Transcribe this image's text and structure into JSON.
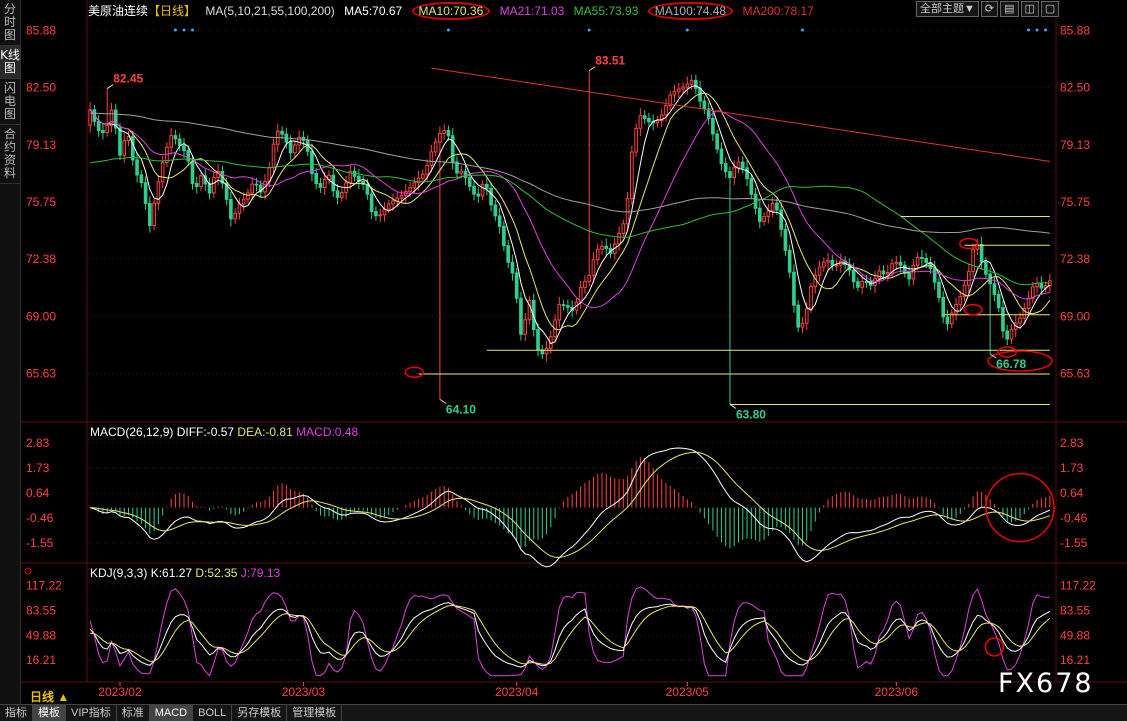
{
  "sidebar": {
    "tabs": [
      {
        "label": "分时图",
        "active": false
      },
      {
        "label": "K线图",
        "active": true
      },
      {
        "label": "闪电图",
        "active": false
      },
      {
        "label": "合约资料",
        "active": false
      }
    ]
  },
  "header": {
    "symbol": "美原油连续",
    "period_tag": "【日线】",
    "ma_params": "MA(5,10,21,55,100,200)",
    "ma5": "MA5:70.67",
    "ma10": "MA10:70.36",
    "ma21": "MA21:71.03",
    "ma55": "MA55:73.93",
    "ma100": "MA100:74.48",
    "ma200": "MA200:78.17"
  },
  "top_buttons": {
    "theme": "全部主题",
    "theme_arrow": "▼"
  },
  "colors": {
    "up": "#ff4040",
    "down": "#2ecf8f",
    "ma5": "#ffffff",
    "ma10": "#e8e870",
    "ma21": "#e040e0",
    "ma55": "#30c030",
    "ma100": "#a0a0a0",
    "ma200": "#e03030",
    "axis": "#ff4040",
    "grid": "#3a1010"
  },
  "period_label": "日线 ▲",
  "watermark": "FX678",
  "bottom_tabs": [
    {
      "label": "指标",
      "active": false
    },
    {
      "label": "模板",
      "active": true
    },
    {
      "label": "VIP指标",
      "active": false
    },
    {
      "label": "标准",
      "active": false
    },
    {
      "label": "MACD",
      "active": true
    },
    {
      "label": "BOLL",
      "active": false
    },
    {
      "label": "另存模板",
      "active": false
    },
    {
      "label": "管理模板",
      "active": false
    }
  ],
  "chart_data": [
    {
      "type": "candlestick",
      "title": "美原油连续【日线】",
      "ylim": [
        63.0,
        86.5
      ],
      "y_ticks": [
        85.88,
        82.5,
        79.13,
        75.75,
        72.38,
        69.0,
        65.63
      ],
      "x_labels": [
        "2023/02",
        "2023/03",
        "2023/04",
        "2023/05",
        "2023/06"
      ],
      "x_label_index": [
        7,
        50,
        100,
        140,
        189
      ],
      "annotations": [
        {
          "text": "82.45",
          "i": 4,
          "value": 82.45,
          "kind": "high"
        },
        {
          "text": "83.51",
          "i": 117,
          "value": 83.51,
          "kind": "high"
        },
        {
          "text": "64.10",
          "i": 82,
          "value": 64.1,
          "kind": "low"
        },
        {
          "text": "63.80",
          "i": 150,
          "value": 63.8,
          "kind": "low"
        },
        {
          "text": "66.78",
          "i": 211,
          "value": 66.78,
          "kind": "low"
        }
      ],
      "candles": [
        [
          80.3,
          81.4,
          80.0,
          81.2
        ],
        [
          81.2,
          81.7,
          79.8,
          80.0
        ],
        [
          80.0,
          80.2,
          79.1,
          79.8
        ],
        [
          79.8,
          82.45,
          79.5,
          81.4
        ],
        [
          81.4,
          81.6,
          78.3,
          78.5
        ],
        [
          78.5,
          80.2,
          78.2,
          80.0
        ],
        [
          80.0,
          80.3,
          77.2,
          77.6
        ],
        [
          77.6,
          78.4,
          76.2,
          76.8
        ],
        [
          76.8,
          77.2,
          73.8,
          74.3
        ],
        [
          74.3,
          76.7,
          73.4,
          76.6
        ],
        [
          76.6,
          78.8,
          76.4,
          78.6
        ],
        [
          78.6,
          80.2,
          78.3,
          79.8
        ],
        [
          79.8,
          80.0,
          78.7,
          79.1
        ],
        [
          79.1,
          79.6,
          78.5,
          78.6
        ],
        [
          78.6,
          78.9,
          76.0,
          76.3
        ],
        [
          76.3,
          77.6,
          76.1,
          77.4
        ],
        [
          77.4,
          78.2,
          75.8,
          76.2
        ],
        [
          76.2,
          78.1,
          75.9,
          77.8
        ],
        [
          77.8,
          78.3,
          76.4,
          76.6
        ],
        [
          76.6,
          76.9,
          74.2,
          74.6
        ],
        [
          74.6,
          75.9,
          74.4,
          75.6
        ],
        [
          75.6,
          76.3,
          75.3,
          76.1
        ],
        [
          76.1,
          77.2,
          75.9,
          77.0
        ],
        [
          77.0,
          77.3,
          76.1,
          76.3
        ],
        [
          76.3,
          77.9,
          76.0,
          77.6
        ],
        [
          77.6,
          80.4,
          77.4,
          80.0
        ],
        [
          80.0,
          81.2,
          79.4,
          79.7
        ],
        [
          79.7,
          80.1,
          78.4,
          78.6
        ],
        [
          78.6,
          79.9,
          78.3,
          79.6
        ],
        [
          79.6,
          80.2,
          79.0,
          79.3
        ],
        [
          79.3,
          79.6,
          76.8,
          77.0
        ],
        [
          77.0,
          77.6,
          76.4,
          76.6
        ],
        [
          76.6,
          77.8,
          76.3,
          77.5
        ],
        [
          77.5,
          77.9,
          75.6,
          75.9
        ],
        [
          75.9,
          76.7,
          75.6,
          76.4
        ],
        [
          76.4,
          78.1,
          76.2,
          77.6
        ],
        [
          77.6,
          78.1,
          76.8,
          77.0
        ],
        [
          77.0,
          77.5,
          76.5,
          76.7
        ],
        [
          76.7,
          77.3,
          74.6,
          74.9
        ],
        [
          74.9,
          75.3,
          74.6,
          75.0
        ],
        [
          75.0,
          75.8,
          74.8,
          75.6
        ],
        [
          75.6,
          76.1,
          75.4,
          75.9
        ],
        [
          75.9,
          76.4,
          75.7,
          76.2
        ],
        [
          76.2,
          77.0,
          75.9,
          76.6
        ],
        [
          76.6,
          77.4,
          76.3,
          77.1
        ],
        [
          77.1,
          77.8,
          76.9,
          77.5
        ],
        [
          77.5,
          79.2,
          77.3,
          78.9
        ],
        [
          78.9,
          80.2,
          78.1,
          79.8
        ],
        [
          79.8,
          80.5,
          79.1,
          80.1
        ],
        [
          80.1,
          81.0,
          77.2,
          77.4
        ],
        [
          77.4,
          78.0,
          76.8,
          77.6
        ],
        [
          77.6,
          77.9,
          76.4,
          76.7
        ],
        [
          76.7,
          77.2,
          75.6,
          75.9
        ],
        [
          75.9,
          77.5,
          75.8,
          77.1
        ],
        [
          77.1,
          77.3,
          75.2,
          75.4
        ],
        [
          75.4,
          75.9,
          74.1,
          74.4
        ],
        [
          74.4,
          74.8,
          72.1,
          72.4
        ],
        [
          72.4,
          72.9,
          70.7,
          71.3
        ],
        [
          71.3,
          71.6,
          67.3,
          67.6
        ],
        [
          67.6,
          70.4,
          66.0,
          70.1
        ],
        [
          70.1,
          70.4,
          66.9,
          67.1
        ],
        [
          67.1,
          67.6,
          64.1,
          66.7
        ],
        [
          66.7,
          68.1,
          66.0,
          67.9
        ],
        [
          67.9,
          70.1,
          67.5,
          69.7
        ],
        [
          69.7,
          70.7,
          69.3,
          69.6
        ],
        [
          69.6,
          70.1,
          69.2,
          69.3
        ],
        [
          69.3,
          71.1,
          69.2,
          70.8
        ],
        [
          70.8,
          71.6,
          70.4,
          71.3
        ],
        [
          71.3,
          73.2,
          71.1,
          72.9
        ],
        [
          72.9,
          73.5,
          72.6,
          73.2
        ],
        [
          73.2,
          73.6,
          72.5,
          72.7
        ],
        [
          72.7,
          74.0,
          72.6,
          73.8
        ],
        [
          73.8,
          75.1,
          73.4,
          74.8
        ],
        [
          74.8,
          79.8,
          74.6,
          79.6
        ],
        [
          79.6,
          81.2,
          79.5,
          80.9
        ],
        [
          80.9,
          81.3,
          80.2,
          80.5
        ],
        [
          80.5,
          81.2,
          80.2,
          80.4
        ],
        [
          80.4,
          81.3,
          80.1,
          81.0
        ],
        [
          81.0,
          82.4,
          80.8,
          82.1
        ],
        [
          82.1,
          83.51,
          81.8,
          82.4
        ],
        [
          82.4,
          83.2,
          82.0,
          82.6
        ],
        [
          82.6,
          83.4,
          82.3,
          83.0
        ],
        [
          83.0,
          83.2,
          81.4,
          81.7
        ],
        [
          81.7,
          82.0,
          80.6,
          80.9
        ],
        [
          80.9,
          81.3,
          79.0,
          79.3
        ],
        [
          79.3,
          79.7,
          77.6,
          77.8
        ],
        [
          77.8,
          78.4,
          76.9,
          77.2
        ],
        [
          77.2,
          78.5,
          77.0,
          78.2
        ],
        [
          78.2,
          78.6,
          77.3,
          77.6
        ],
        [
          77.6,
          78.1,
          75.7,
          76.0
        ],
        [
          76.0,
          76.3,
          74.3,
          74.6
        ],
        [
          74.6,
          75.4,
          74.3,
          75.1
        ],
        [
          75.1,
          76.2,
          74.9,
          75.9
        ],
        [
          75.9,
          76.2,
          73.6,
          73.9
        ],
        [
          73.9,
          74.2,
          71.4,
          71.7
        ],
        [
          71.7,
          72.0,
          67.9,
          68.3
        ],
        [
          68.3,
          69.7,
          63.8,
          68.7
        ],
        [
          68.7,
          71.3,
          68.4,
          71.0
        ],
        [
          71.0,
          72.2,
          70.6,
          71.9
        ],
        [
          71.9,
          72.7,
          71.5,
          72.4
        ],
        [
          72.4,
          72.8,
          71.6,
          71.9
        ],
        [
          71.9,
          72.6,
          71.5,
          72.3
        ],
        [
          72.3,
          72.8,
          71.6,
          71.8
        ],
        [
          71.8,
          72.1,
          70.3,
          70.6
        ],
        [
          70.6,
          71.4,
          70.4,
          71.2
        ],
        [
          71.2,
          71.6,
          70.5,
          70.8
        ],
        [
          70.8,
          72.0,
          70.5,
          71.7
        ],
        [
          71.7,
          72.9,
          71.2,
          71.4
        ],
        [
          71.4,
          72.6,
          71.1,
          72.3
        ],
        [
          72.3,
          73.2,
          72.0,
          72.0
        ],
        [
          72.0,
          72.3,
          70.8,
          71.1
        ],
        [
          71.1,
          72.7,
          70.9,
          72.5
        ],
        [
          72.5,
          73.6,
          72.2,
          72.4
        ],
        [
          72.4,
          72.9,
          71.6,
          71.8
        ],
        [
          71.8,
          72.1,
          70.0,
          70.3
        ],
        [
          70.3,
          70.6,
          68.0,
          68.3
        ],
        [
          68.3,
          69.6,
          68.0,
          69.4
        ],
        [
          69.4,
          70.4,
          69.1,
          70.2
        ],
        [
          70.2,
          71.6,
          70.0,
          71.4
        ],
        [
          71.4,
          74.1,
          71.1,
          73.7
        ],
        [
          73.7,
          74.3,
          71.6,
          71.9
        ],
        [
          71.9,
          72.4,
          70.6,
          70.9
        ],
        [
          70.9,
          71.3,
          69.6,
          69.8
        ],
        [
          69.8,
          70.1,
          66.78,
          67.4
        ],
        [
          67.4,
          68.7,
          67.1,
          68.4
        ],
        [
          68.4,
          69.0,
          68.0,
          68.9
        ],
        [
          68.9,
          70.1,
          68.6,
          69.9
        ],
        [
          69.9,
          71.4,
          69.6,
          71.1
        ],
        [
          71.1,
          71.6,
          70.3,
          70.6
        ],
        [
          70.6,
          71.2,
          70.4,
          71.1
        ]
      ],
      "horizontal_levels": [
        {
          "value": 74.9,
          "from": 190,
          "to": 225
        },
        {
          "value": 73.2,
          "from": 205,
          "to": 225
        },
        {
          "value": 69.1,
          "from": 200,
          "to": 225
        },
        {
          "value": 67.0,
          "from": 93,
          "to": 225
        },
        {
          "value": 65.6,
          "from": 77,
          "to": 225
        },
        {
          "value": 63.8,
          "from": 150,
          "to": 225
        }
      ],
      "marks": [
        {
          "i": 76,
          "value": 65.7
        },
        {
          "i": 206,
          "value": 73.3
        },
        {
          "i": 207,
          "value": 69.4
        },
        {
          "i": 215,
          "value": 66.9
        }
      ]
    },
    {
      "type": "macd",
      "title": "MACD(26,12,9)",
      "diff": "DIFF:-0.57",
      "dea": "DEA:-0.81",
      "macd": "MACD:0.48",
      "ylim": [
        -2.3,
        3.1
      ],
      "y_ticks": [
        2.83,
        1.73,
        0.64,
        -0.46,
        -1.55
      ]
    },
    {
      "type": "kdj",
      "title": "KDJ(9,3,3)",
      "k": "K:61.27",
      "d": "D:52.35",
      "j": "J:79.13",
      "ylim": [
        0,
        125
      ],
      "y_ticks": [
        117.22,
        83.55,
        49.88,
        16.21
      ]
    }
  ]
}
